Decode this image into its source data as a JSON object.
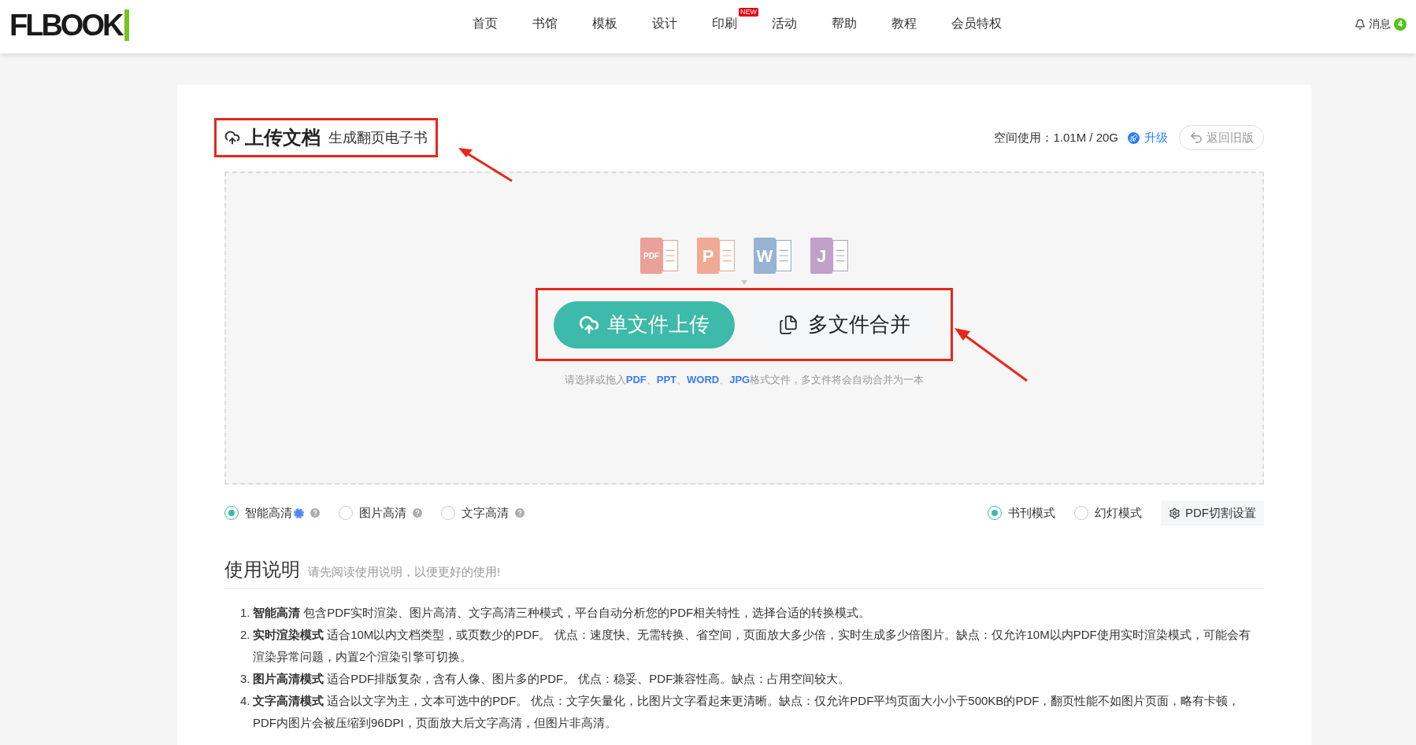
{
  "header": {
    "logo": "FLBOOK",
    "nav": [
      {
        "label": "首页"
      },
      {
        "label": "书馆"
      },
      {
        "label": "模板"
      },
      {
        "label": "设计"
      },
      {
        "label": "印刷",
        "badge": "NEW"
      },
      {
        "label": "活动"
      },
      {
        "label": "帮助"
      },
      {
        "label": "教程"
      },
      {
        "label": "会员特权"
      }
    ],
    "messages": {
      "label": "消息",
      "count": "4"
    }
  },
  "upload": {
    "title": "上传文档",
    "subtitle": "生成翻页电子书",
    "storage": "空间使用：1.01M / 20G",
    "upgrade": "升级",
    "old_version": "返回旧版",
    "file_types": [
      {
        "label": "PDF",
        "color": "#e9a199"
      },
      {
        "label": "P",
        "color": "#eeaa93"
      },
      {
        "label": "W",
        "color": "#97b3d1"
      },
      {
        "label": "J",
        "color": "#bea0c8"
      }
    ],
    "buttons": [
      {
        "kind": "primary",
        "label": "单文件上传"
      },
      {
        "kind": "secondary",
        "label": "多文件合并"
      }
    ],
    "hint": "请选择或拖入**PDF**、**PPT**、**WORD**、**JPG**格式文件，多文件将会自动合并为一本",
    "quality_options": [
      {
        "label": "智能高清",
        "selected": true,
        "recommended": true
      },
      {
        "label": "图片高清",
        "selected": false,
        "recommended": false
      },
      {
        "label": "文字高清",
        "selected": false,
        "recommended": false
      }
    ],
    "mode_options": [
      {
        "label": "书刊模式",
        "selected": true
      },
      {
        "label": "幻灯模式",
        "selected": false
      }
    ],
    "split_settings": "PDF切割设置"
  },
  "instructions": {
    "title": "使用说明",
    "subtitle": "请先阅读使用说明，以便更好的使用!",
    "items": [
      {
        "number": "1.",
        "term": "智能高清",
        "text": "包含PDF实时渲染、图片高清、文字高清三种模式，平台自动分析您的PDF相关特性，选择合适的转换模式。"
      },
      {
        "number": "2.",
        "term": "实时渲染模式",
        "text": "适合10M以内文档类型，或页数少的PDF。 优点：速度快、无需转换、省空间，页面放大多少倍，实时生成多少倍图片。缺点：仅允许10M以内PDF使用实时渲染模式，可能会有渲染异常问题，内置2个渲染引擎可切换。"
      },
      {
        "number": "3.",
        "term": "图片高清模式",
        "text": "适合PDF排版复杂，含有人像、图片多的PDF。 优点：稳妥、PDF兼容性高。缺点：占用空间较大。"
      },
      {
        "number": "4.",
        "term": "文字高清模式",
        "text": "适合以文字为主，文本可选中的PDF。 优点：文字矢量化，比图片文字看起来更清晰。缺点：仅允许PDF平均页面大小小于500KB的PDF，翻页性能不如图片页面，略有卡顿，PDF内图片会被压缩到96DPI，页面放大后文字高清，但图片非高清。"
      }
    ]
  }
}
